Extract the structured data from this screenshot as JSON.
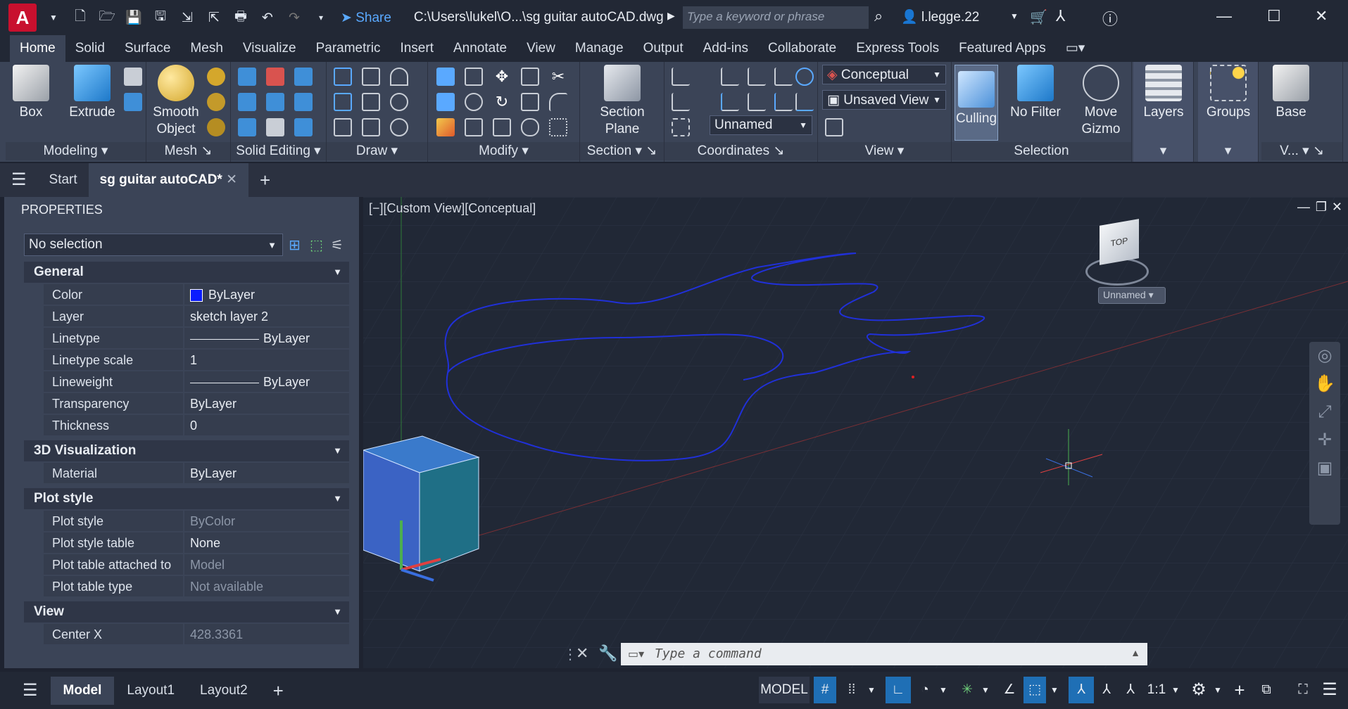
{
  "titlebar": {
    "app_logo": "A",
    "share_label": "Share",
    "file_path": "C:\\Users\\lukel\\O...\\sg guitar autoCAD.dwg",
    "search_placeholder": "Type a keyword or phrase",
    "user_name": "l.legge.22"
  },
  "menu_tabs": [
    "Home",
    "Solid",
    "Surface",
    "Mesh",
    "Visualize",
    "Parametric",
    "Insert",
    "Annotate",
    "View",
    "Manage",
    "Output",
    "Add-ins",
    "Collaborate",
    "Express Tools",
    "Featured Apps"
  ],
  "ribbon": {
    "box": "Box",
    "extrude": "Extrude",
    "smooth_object_1": "Smooth",
    "smooth_object_2": "Object",
    "section_plane_1": "Section",
    "section_plane_2": "Plane",
    "visual_style": "Conceptual",
    "view_name": "Unsaved View",
    "ucs_name": "Unnamed",
    "culling": "Culling",
    "no_filter": "No Filter",
    "move_gizmo_1": "Move",
    "move_gizmo_2": "Gizmo",
    "layers": "Layers",
    "groups": "Groups",
    "base": "Base",
    "panels": {
      "modeling": "Modeling",
      "mesh": "Mesh",
      "solid_editing": "Solid Editing",
      "draw": "Draw",
      "modify": "Modify",
      "section": "Section",
      "coordinates": "Coordinates",
      "view": "View",
      "selection": "Selection",
      "v_short": "V..."
    }
  },
  "doc_tabs": {
    "start": "Start",
    "active": "sg guitar autoCAD*"
  },
  "properties": {
    "title": "PROPERTIES",
    "selection": "No selection",
    "sections": {
      "general": "General",
      "viz3d": "3D Visualization",
      "plot_style": "Plot style",
      "view": "View"
    },
    "general": [
      {
        "k": "Color",
        "v": "ByLayer"
      },
      {
        "k": "Layer",
        "v": "sketch layer 2"
      },
      {
        "k": "Linetype",
        "v": "ByLayer"
      },
      {
        "k": "Linetype scale",
        "v": "1"
      },
      {
        "k": "Lineweight",
        "v": "ByLayer"
      },
      {
        "k": "Transparency",
        "v": "ByLayer"
      },
      {
        "k": "Thickness",
        "v": "0"
      }
    ],
    "viz3d": [
      {
        "k": "Material",
        "v": "ByLayer"
      }
    ],
    "plot": [
      {
        "k": "Plot style",
        "v": "ByColor"
      },
      {
        "k": "Plot style table",
        "v": "None"
      },
      {
        "k": "Plot table attached to",
        "v": "Model"
      },
      {
        "k": "Plot table type",
        "v": "Not available"
      }
    ],
    "view": [
      {
        "k": "Center X",
        "v": "428.3361"
      }
    ],
    "color_swatch": "#0a1cff"
  },
  "viewport": {
    "label": "[−][Custom View][Conceptual]",
    "viewcube_top": "TOP",
    "ucs_dropdown": "Unnamed"
  },
  "command": {
    "placeholder": "Type a command"
  },
  "status": {
    "tabs": [
      "Model",
      "Layout1",
      "Layout2"
    ],
    "model_label": "MODEL",
    "scale": "1:1"
  }
}
